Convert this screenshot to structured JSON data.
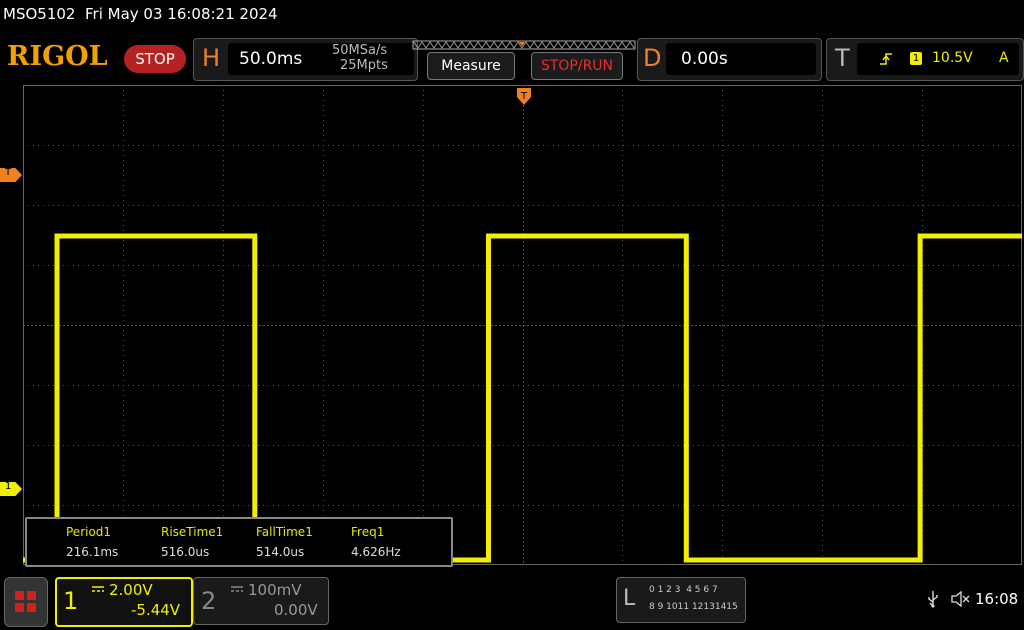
{
  "titlebar": {
    "model": "MSO5102",
    "datetime": "Fri May 03 16:08:21 2024"
  },
  "brand": {
    "logo": "RIGOL",
    "run_state": "STOP"
  },
  "horizontal": {
    "letter": "H",
    "timebase": "50.0ms",
    "sample_rate": "50MSa/s",
    "memory_depth": "25Mpts"
  },
  "buttons": {
    "measure": "Measure",
    "stop_run": "STOP/RUN"
  },
  "delay": {
    "letter": "D",
    "value": "0.00s"
  },
  "trigger": {
    "letter": "T",
    "channel": "1",
    "level": "10.5V",
    "mode": "A"
  },
  "markers": {
    "trigger_level": "T",
    "channel1_ground": "1"
  },
  "measurements": [
    {
      "label": "Period1",
      "value": "216.1ms"
    },
    {
      "label": "RiseTime1",
      "value": "516.0us"
    },
    {
      "label": "FallTime1",
      "value": "514.0us"
    },
    {
      "label": "Freq1",
      "value": "4.626Hz"
    }
  ],
  "channels": [
    {
      "number": "1",
      "scale": "2.00V",
      "offset": "-5.44V",
      "color": "#f2ee00"
    },
    {
      "number": "2",
      "scale": "100mV",
      "offset": "0.00V",
      "color": "#888888"
    }
  ],
  "logic": {
    "letter": "L",
    "row1": "0 1 2 3  4 5 6 7",
    "row2": "8 9 1011 12131415"
  },
  "status": {
    "time": "16:08"
  },
  "colors": {
    "trace": "#f2ee00",
    "accent": "#f08020",
    "stop": "#b52222",
    "grid": "#555555"
  },
  "waveform": {
    "type": "square",
    "high_div": 5.4,
    "low_div": 0.0,
    "edges_ms": [
      17,
      116,
      233,
      332,
      449
    ]
  }
}
